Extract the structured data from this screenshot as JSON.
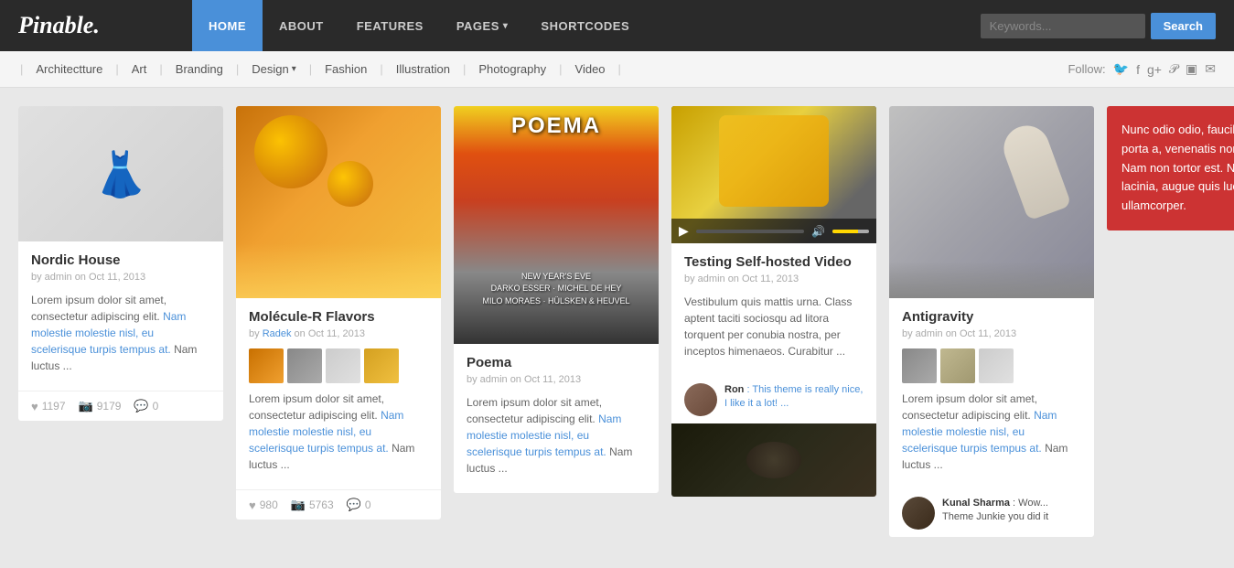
{
  "header": {
    "logo": "Pinable.",
    "nav": [
      {
        "label": "HOME",
        "active": true,
        "id": "home"
      },
      {
        "label": "ABOUT",
        "active": false,
        "id": "about"
      },
      {
        "label": "FEATURES",
        "active": false,
        "id": "features"
      },
      {
        "label": "PAGES",
        "active": false,
        "id": "pages",
        "dropdown": true
      },
      {
        "label": "SHORTCODES",
        "active": false,
        "id": "shortcodes"
      }
    ],
    "search": {
      "placeholder": "Keywords...",
      "button_label": "Search"
    }
  },
  "subnav": {
    "items": [
      {
        "label": "Architectture",
        "id": "architecture"
      },
      {
        "label": "Art",
        "id": "art"
      },
      {
        "label": "Branding",
        "id": "branding"
      },
      {
        "label": "Design",
        "id": "design",
        "dropdown": true
      },
      {
        "label": "Fashion",
        "id": "fashion"
      },
      {
        "label": "Illustration",
        "id": "illustration"
      },
      {
        "label": "Photography",
        "id": "photography"
      },
      {
        "label": "Video",
        "id": "video"
      }
    ],
    "follow_label": "Follow:"
  },
  "cards": [
    {
      "id": "nordic-house",
      "title": "Nordic House",
      "meta": "by admin on Oct 11, 2013",
      "excerpt": "Lorem ipsum dolor sit amet, consectetur adipiscing elit. Nam molestie molestie nisl, eu scelerisque turpis tempus at. Nam luctus ...",
      "likes": "1197",
      "images": "9179",
      "comments": "0",
      "type": "image"
    },
    {
      "id": "molecule-r",
      "title": "Molécule-R Flavors",
      "meta_by": "by",
      "meta_author": "Radek",
      "meta_date": "on Oct 11, 2013",
      "excerpt": "Lorem ipsum dolor sit amet, consectetur adipiscing elit. Nam molestie molestie nisl, eu scelerisque turpis tempus at. Nam luctus ...",
      "likes": "980",
      "images": "5763",
      "comments": "0",
      "type": "gallery"
    },
    {
      "id": "poema",
      "title": "Poema",
      "meta": "by admin on Oct 11, 2013",
      "excerpt": "Lorem ipsum dolor sit amet, consectetur adipiscing elit. Nam molestie molestie nisl, eu scelerisque turpis tempus at. Nam luctus ...",
      "type": "image",
      "image_title": "POEMA"
    },
    {
      "id": "self-hosted-video",
      "title": "Testing Self-hosted Video",
      "meta": "by admin on Oct 11, 2013",
      "excerpt": "Vestibulum quis mattis urna. Class aptent taciti sociosqu ad litora torquent per conubia nostra, per inceptos himenaeos. Curabitur ...",
      "type": "video",
      "commenter": "Ron",
      "comment_text": ": This theme is really nice, I like it a lot! ...",
      "food_img": true
    },
    {
      "id": "antigravity",
      "title": "Antigravity",
      "meta": "by admin on Oct 11, 2013",
      "excerpt": "Lorem ipsum dolor sit amet, consectetur adipiscing elit. Nam molestie molestie nisl, eu scelerisque turpis tempus at. Nam luctus ...",
      "type": "gallery",
      "commenter": "Kunal Sharma",
      "comment_text": ": Wow... Theme Junkie you did it"
    }
  ],
  "promo": {
    "text": "Nunc odio odio, faucibus non porta a, venenatis non mauris. Nam non tortor est. Nullam lacinia, augue quis luctus ullamcorper."
  }
}
